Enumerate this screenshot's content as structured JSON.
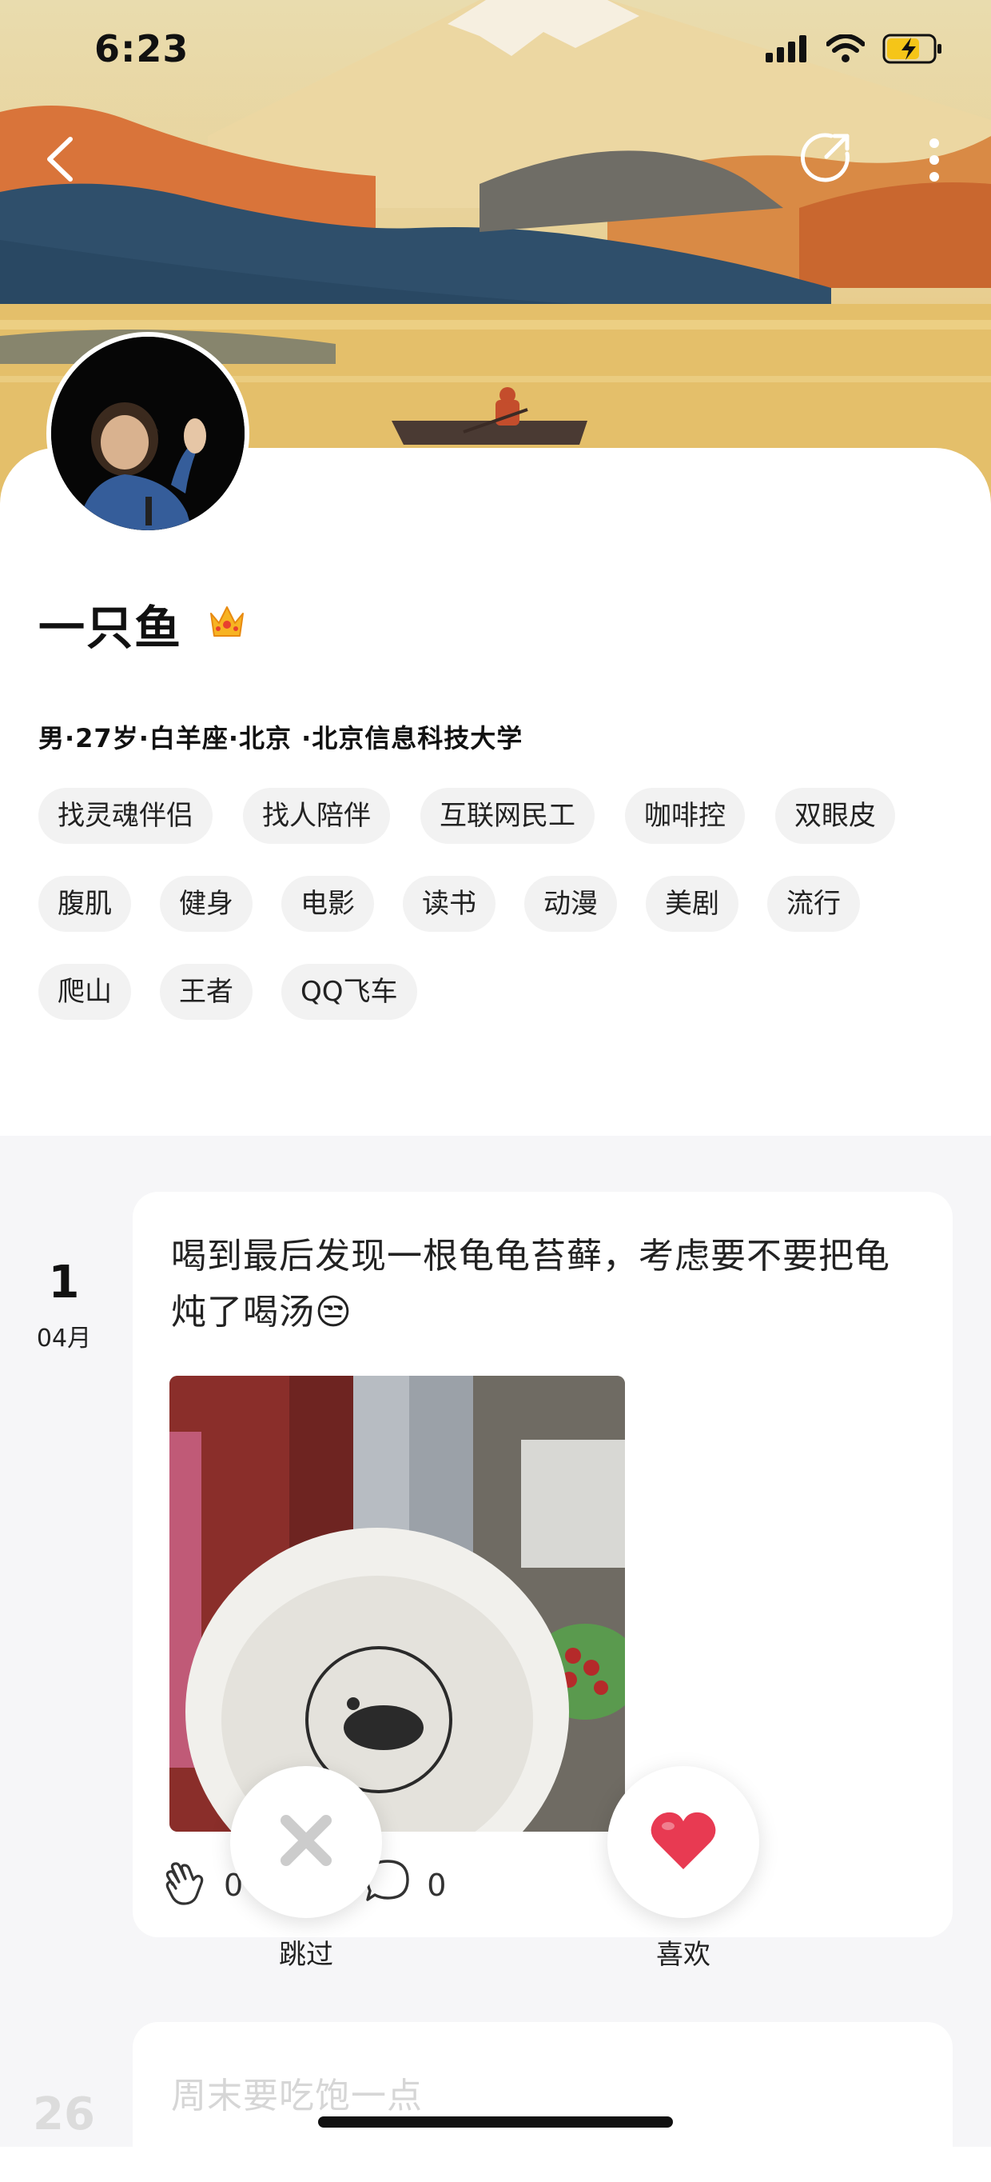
{
  "status_bar": {
    "time": "6:23"
  },
  "profile": {
    "name": "一只鱼",
    "info": "男·27岁·白羊座·北京 ·北京信息科技大学",
    "tags": [
      [
        "找灵魂伴侣",
        "找人陪伴",
        "互联网民工",
        "咖啡控",
        "双眼皮"
      ],
      [
        "腹肌",
        "健身",
        "电影",
        "读书",
        "动漫",
        "美剧",
        "流行"
      ],
      [
        "爬山",
        "王者",
        "QQ飞车"
      ]
    ]
  },
  "posts": [
    {
      "day": "1",
      "month": "04月",
      "text": "喝到最后发现一根龟龟苔藓，考虑要不要把龟炖了喝汤😒",
      "claps": "0",
      "comments": "0"
    },
    {
      "day": "26",
      "text": "周末要吃饱一点"
    }
  ],
  "actions": {
    "skip_label": "跳过",
    "like_label": "喜欢"
  },
  "colors": {
    "like_heart": "#e83a52",
    "skip_x": "#cccccc",
    "battery": "#f5c518"
  }
}
